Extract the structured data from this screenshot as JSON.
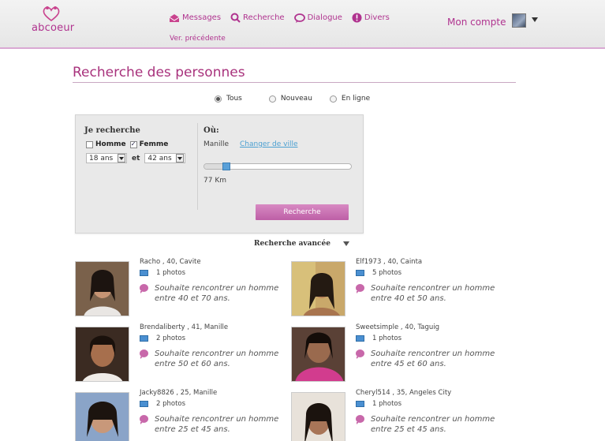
{
  "brand": {
    "logo_text": "abcoeur"
  },
  "nav": {
    "items": [
      {
        "label": "Messages",
        "icon": "envelope-icon"
      },
      {
        "label": "Recherche",
        "icon": "search-icon"
      },
      {
        "label": "Dialogue",
        "icon": "chat-bubble-icon"
      },
      {
        "label": "Divers",
        "icon": "info-icon"
      }
    ],
    "prev_version": "Ver. précédente",
    "account": "Mon compte"
  },
  "page": {
    "title": "Recherche des personnes"
  },
  "filters": {
    "options": [
      {
        "label": "Tous",
        "selected": true
      },
      {
        "label": "Nouveau",
        "selected": false
      },
      {
        "label": "En ligne",
        "selected": false
      }
    ]
  },
  "search": {
    "looking_for_label": "Je recherche",
    "man_label": "Homme",
    "man_checked": false,
    "woman_label": "Femme",
    "woman_checked": true,
    "age_min": "18 ans",
    "and_label": "et",
    "age_max": "42 ans",
    "where_label": "Où:",
    "city": "Manille",
    "change_city": "Changer de ville",
    "distance": "77 Km",
    "distance_fraction": 0.15,
    "button": "Recherche"
  },
  "advanced": "Recherche avancée",
  "results": [
    {
      "meta": "Racho , 40, Cavite",
      "photos": "1 photos",
      "wish": "Souhaite rencontrer un homme entre 40 et 70 ans."
    },
    {
      "meta": "Elf1973 , 40, Cainta",
      "photos": "5 photos",
      "wish": "Souhaite rencontrer un homme entre 40 et 50 ans."
    },
    {
      "meta": "Brendaliberty , 41, Manille",
      "photos": "2 photos",
      "wish": "Souhaite rencontrer un homme entre 50 et 60 ans."
    },
    {
      "meta": "Sweetsimple , 40, Taguig",
      "photos": "1 photos",
      "wish": "Souhaite rencontrer un homme entre 45 et 60 ans."
    },
    {
      "meta": "Jacky8826 , 25, Manille",
      "photos": "2 photos",
      "wish": "Souhaite rencontrer un homme entre 25 et 45 ans."
    },
    {
      "meta": "Cheryl514 , 35, Angeles City",
      "photos": "1 photos",
      "wish": "Souhaite rencontrer un homme entre 25 et 45 ans."
    }
  ],
  "colors": {
    "accent": "#b0338f",
    "button": "#c870b4",
    "link": "#4a9fd1"
  }
}
